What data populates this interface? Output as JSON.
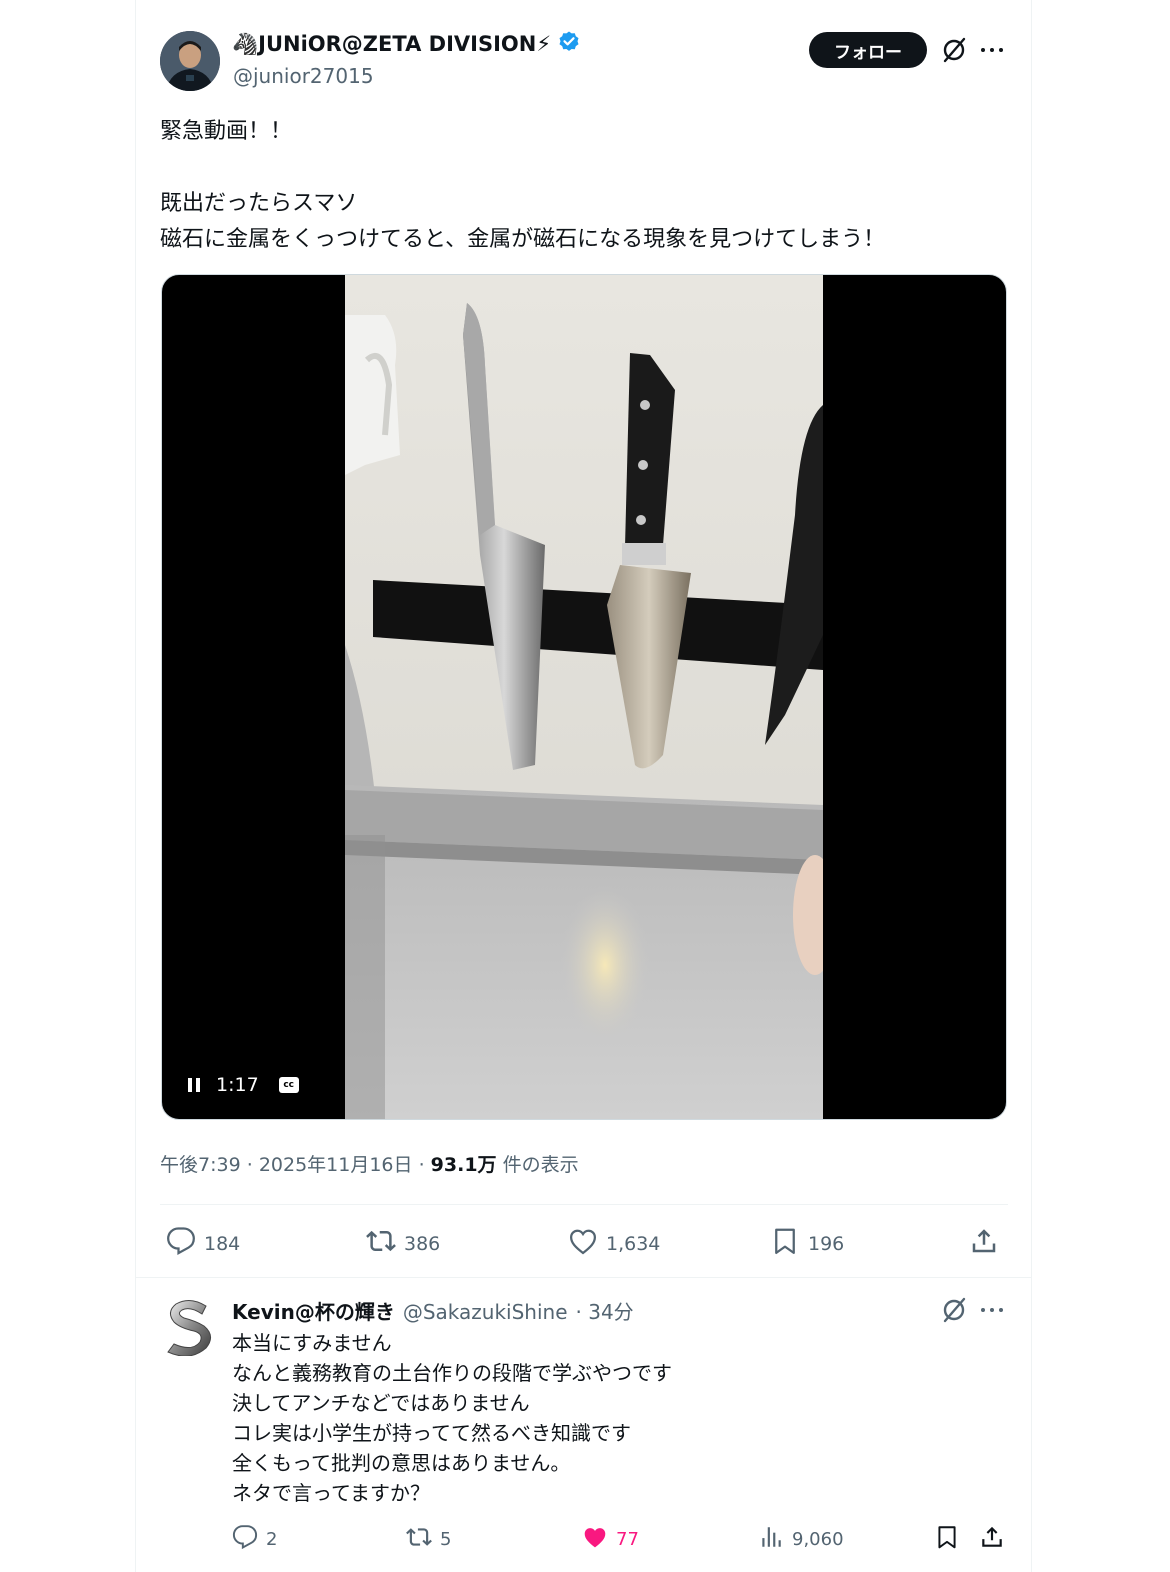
{
  "author": {
    "display_name": "🦓JUNiOR@ZETA DIVISION⚡",
    "handle": "@junior27015",
    "verified": true
  },
  "header": {
    "follow_label": "フォロー",
    "grok_icon": "grok-icon",
    "more_icon": "more-icon"
  },
  "tweet": {
    "text": "緊急動画！！\n\n既出だったらスマソ\n磁石に金属をくっつけてると、金属が磁石になる現象を見つけてしまう！"
  },
  "video": {
    "time": "1:17",
    "cc_label": "cc",
    "state": "playing"
  },
  "meta": {
    "time": "午後7:39",
    "sep1": "·",
    "date": "2025年11月16日",
    "sep2": "·",
    "views": "93.1万",
    "views_suffix": "件の表示"
  },
  "actions": {
    "replies": "184",
    "reposts": "386",
    "likes": "1,634",
    "bookmarks": "196"
  },
  "reply": {
    "display_name": "Kevin@杯の輝き",
    "handle": "@SakazukiShine",
    "time": "· 34分",
    "text": "本当にすみません\nなんと義務教育の土台作りの段階で学ぶやつです\n決してアンチなどではありません\nコレ実は小学生が持ってて然るべき知識です\n全くもって批判の意思はありません。\nネタで言ってますか？",
    "replies": "2",
    "reposts": "5",
    "likes": "77",
    "views": "9,060"
  },
  "colors": {
    "accent_like": "#f91880",
    "verified": "#1d9bf0",
    "text_secondary": "#536471"
  }
}
